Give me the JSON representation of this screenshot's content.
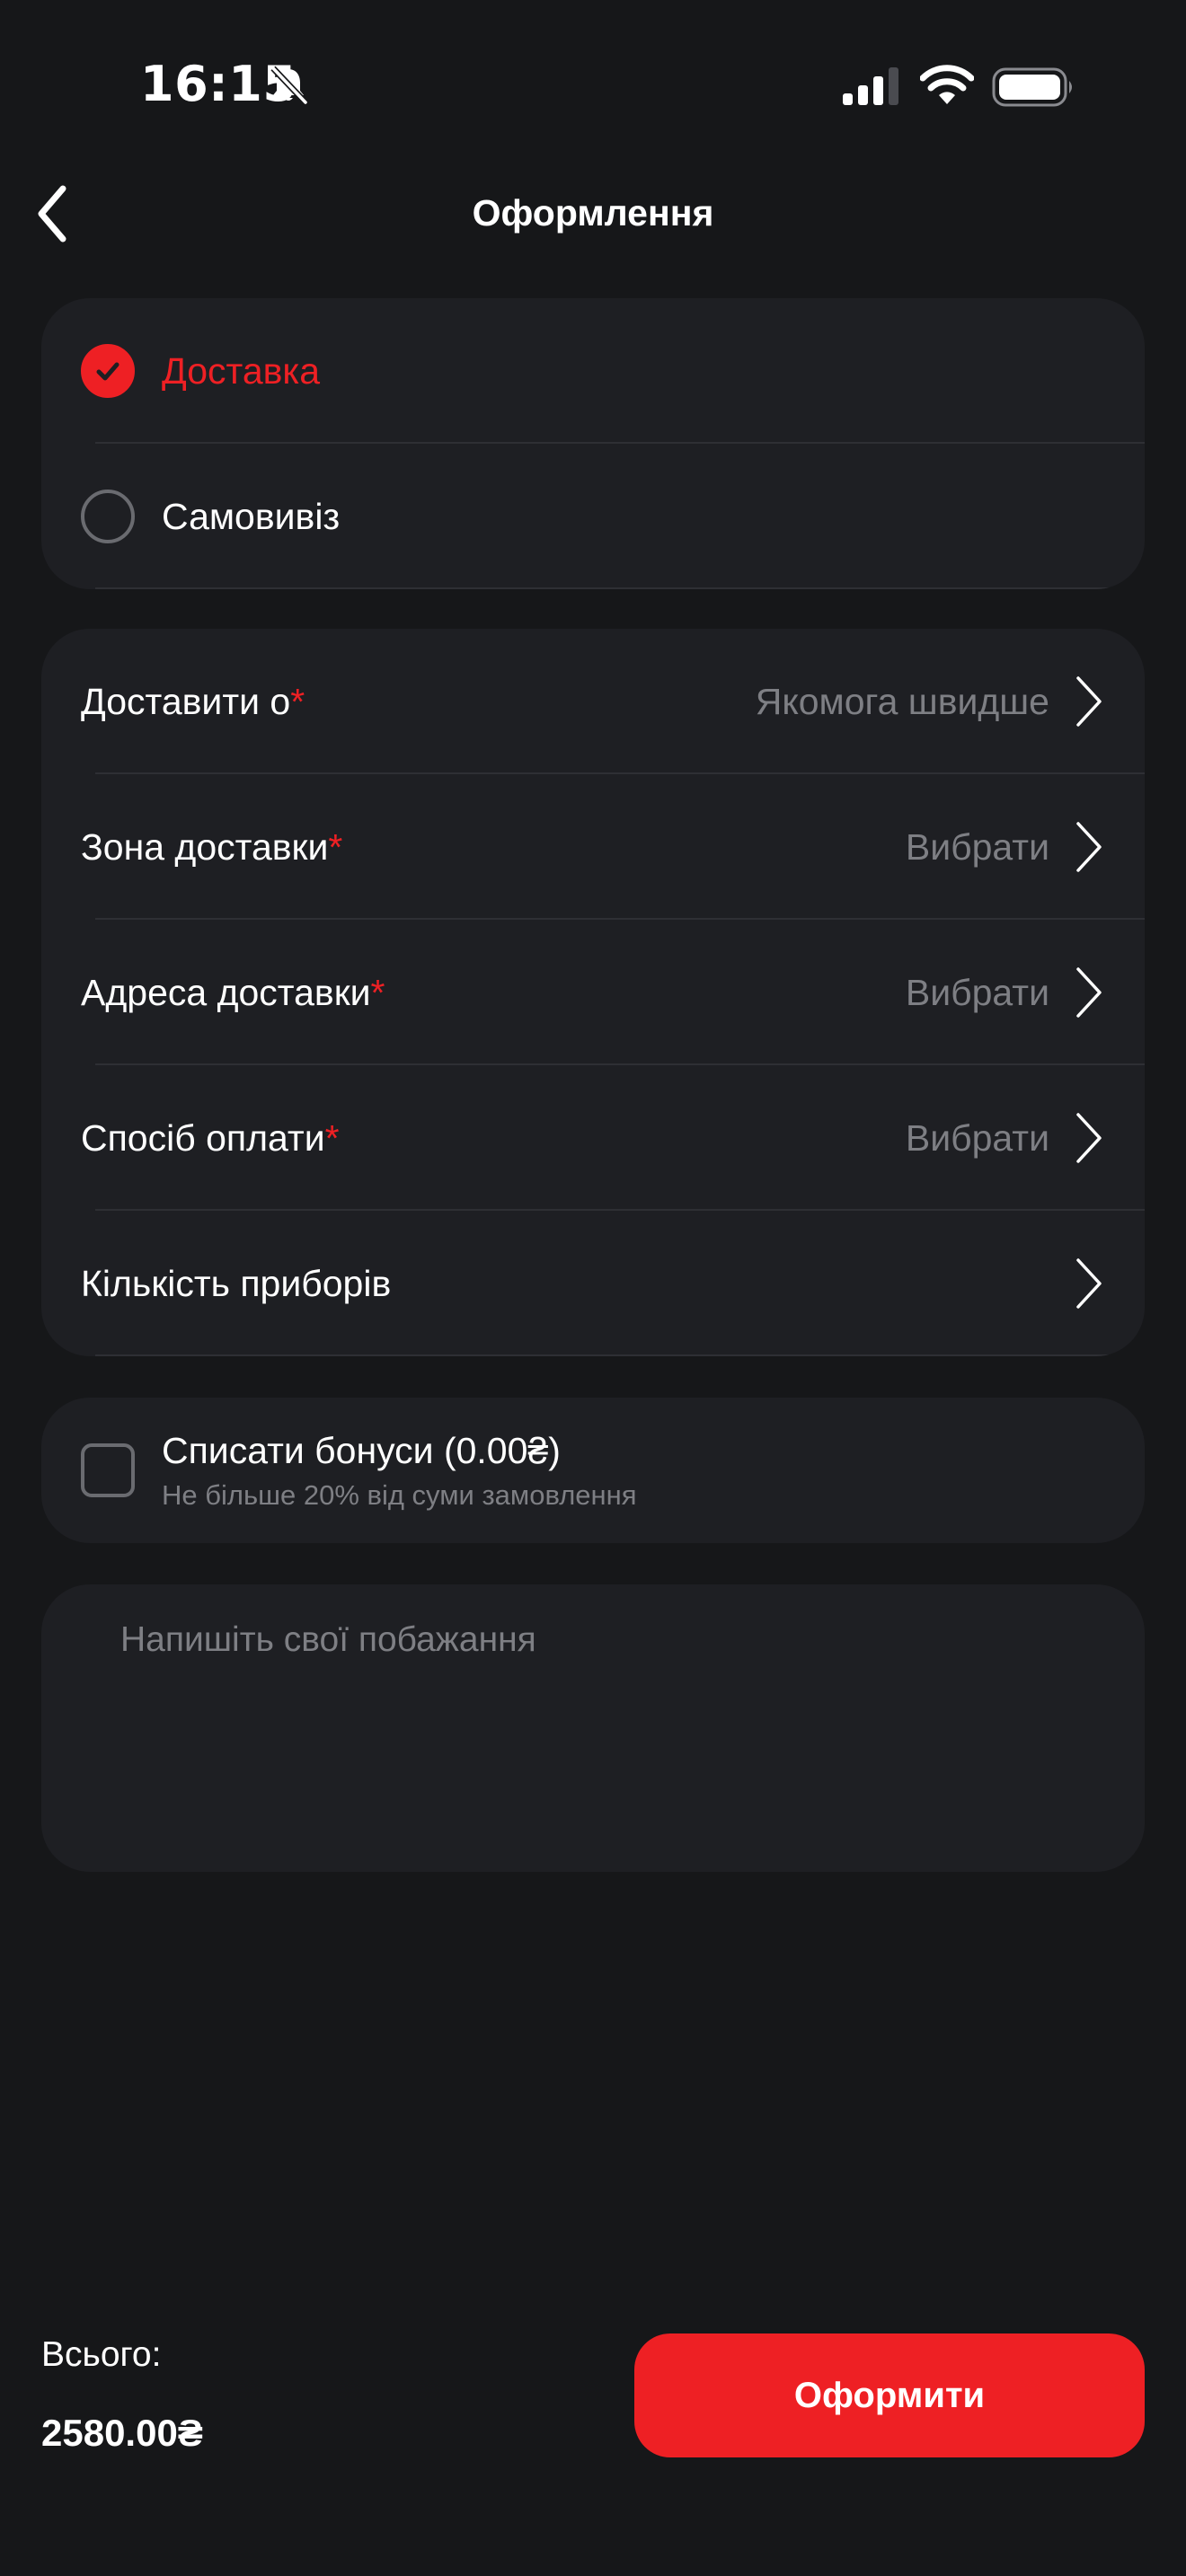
{
  "status_bar": {
    "time": "16:15"
  },
  "nav": {
    "title": "Оформлення"
  },
  "delivery_method": {
    "options": [
      {
        "label": "Доставка",
        "selected": true
      },
      {
        "label": "Самовивіз",
        "selected": false
      }
    ]
  },
  "fields": [
    {
      "label": "Доставити о",
      "required_mark": "*",
      "value": "Якомога швидше"
    },
    {
      "label": "Зона доставки",
      "required_mark": "*",
      "value": "Вибрати"
    },
    {
      "label": "Адреса доставки",
      "required_mark": "*",
      "value": "Вибрати"
    },
    {
      "label": "Спосіб оплати",
      "required_mark": "*",
      "value": "Вибрати"
    },
    {
      "label": "Кількість приборів",
      "required_mark": "",
      "value": ""
    }
  ],
  "bonus": {
    "title": "Списати бонуси (0.00₴)",
    "subtitle": "Не більше 20% від суми замовлення",
    "checked": false
  },
  "comment": {
    "placeholder": "Напишіть свої побажання",
    "value": ""
  },
  "footer": {
    "total_label": "Всього:",
    "total_value": "2580.00₴",
    "submit_label": "Оформити"
  },
  "colors": {
    "accent": "#ee2024",
    "background": "#161719",
    "card": "#1e1f23",
    "muted_text": "#7e7f84"
  },
  "icons": [
    "bell-slash-icon",
    "signal-icon",
    "wifi-icon",
    "battery-icon",
    "back-arrow-icon",
    "checkmark-icon",
    "chevron-right-icon"
  ]
}
